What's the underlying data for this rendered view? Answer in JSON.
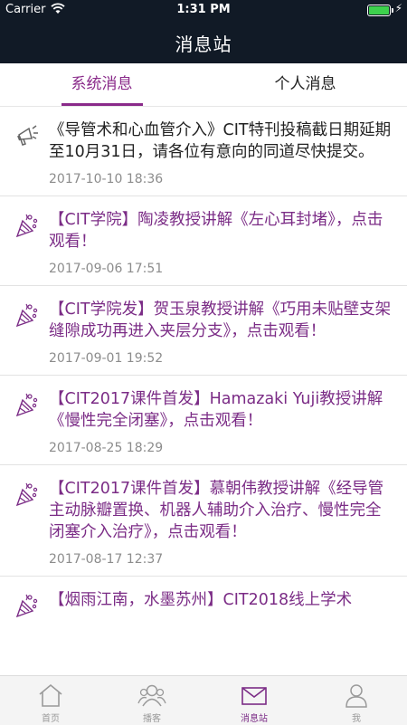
{
  "status_bar": {
    "carrier": "Carrier",
    "time": "1:31 PM"
  },
  "header": {
    "title": "消息站"
  },
  "tabs": [
    {
      "label": "系统消息",
      "active": true
    },
    {
      "label": "个人消息",
      "active": false
    }
  ],
  "messages": [
    {
      "icon": "megaphone-icon",
      "text": "《导管术和心血管介入》CIT特刊投稿截日期延期至10月31日，请各位有意向的同道尽快提交。",
      "date": "2017-10-10 18:36",
      "highlight": false
    },
    {
      "icon": "party-icon",
      "text": "【CIT学院】陶凌教授讲解《左心耳封堵》，点击观看！",
      "date": "2017-09-06 17:51",
      "highlight": true
    },
    {
      "icon": "party-icon",
      "text": "【CIT学院发】贺玉泉教授讲解《巧用未贴壁支架缝隙成功再进入夹层分支》，点击观看！",
      "date": "2017-09-01 19:52",
      "highlight": true
    },
    {
      "icon": "party-icon",
      "text": "【CIT2017课件首发】Hamazaki Yuji教授讲解《慢性完全闭塞》，点击观看！",
      "date": "2017-08-25 18:29",
      "highlight": true
    },
    {
      "icon": "party-icon",
      "text": "【CIT2017课件首发】慕朝伟教授讲解《经导管主动脉瓣置换、机器人辅助介入治疗、慢性完全闭塞介入治疗》，点击观看！",
      "date": "2017-08-17 12:37",
      "highlight": true
    },
    {
      "icon": "party-icon",
      "text": "【烟雨江南，水墨苏州】CIT2018线上学术",
      "date": "",
      "highlight": true
    }
  ],
  "tabbar": [
    {
      "label": "首页",
      "icon": "home-icon",
      "active": false
    },
    {
      "label": "播客",
      "icon": "people-icon",
      "active": false
    },
    {
      "label": "消息站",
      "icon": "mail-icon",
      "active": true
    },
    {
      "label": "我",
      "icon": "person-icon",
      "active": false
    }
  ],
  "colors": {
    "accent": "#7b2c86",
    "topbar": "#111a26"
  }
}
